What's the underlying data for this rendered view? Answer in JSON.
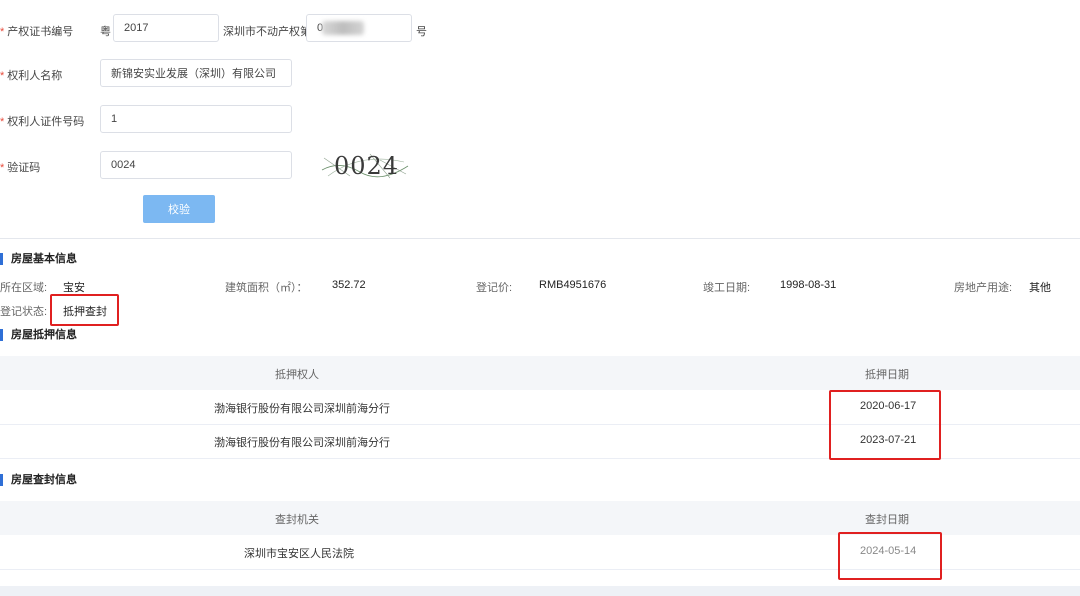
{
  "form": {
    "cert_label": "产权证书编号",
    "cert_prefix": "粤",
    "cert_year": "2017",
    "cert_mid_label": "深圳市不动产权第",
    "cert_no_visible": "0",
    "cert_suffix": "号",
    "owner_label": "权利人名称",
    "owner_value": "新锦安实业发展（深圳）有限公司",
    "id_label": "权利人证件号码",
    "id_value": "1",
    "captcha_label": "验证码",
    "captcha_value": "0024",
    "captcha_image_text": "0024",
    "verify_button": "校验"
  },
  "basic": {
    "title": "房屋基本信息",
    "district_label": "所在区域:",
    "district_value": "宝安",
    "area_label": "建筑面积（㎡）：",
    "area_value": "352.72",
    "price_label": "登记价:",
    "price_value": "RMB4951676",
    "completion_label": "竣工日期:",
    "completion_value": "1998-08-31",
    "use_label": "房地产用途:",
    "use_value": "其他",
    "status_label": "登记状态:",
    "status_value": "抵押查封"
  },
  "mortgage": {
    "title": "房屋抵押信息",
    "headers": [
      "抵押权人",
      "抵押日期"
    ],
    "rows": [
      {
        "holder": "渤海银行股份有限公司深圳前海分行",
        "date": "2020-06-17"
      },
      {
        "holder": "渤海银行股份有限公司深圳前海分行",
        "date": "2023-07-21"
      }
    ]
  },
  "seizure": {
    "title": "房屋查封信息",
    "headers": [
      "查封机关",
      "查封日期"
    ],
    "rows": [
      {
        "authority": "深圳市宝安区人民法院",
        "date": "2024-05-14"
      }
    ]
  },
  "colors": {
    "accent": "#2f6fd6",
    "button": "#7cb8f2",
    "highlight": "#e02020",
    "required": "#e74c3c"
  }
}
